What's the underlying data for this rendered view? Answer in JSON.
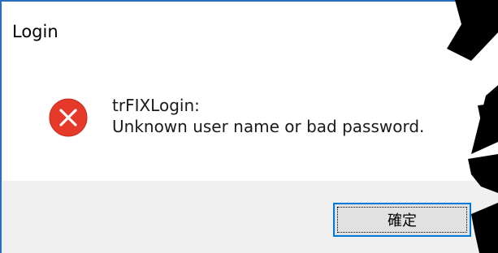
{
  "dialog": {
    "title": "Login",
    "message_source": "trFIXLogin:",
    "message_body": "Unknown user name or bad password.",
    "ok_label": "確定",
    "icon": "error-icon",
    "close_icon": "close-icon"
  },
  "colors": {
    "window_border": "#2b6fbe",
    "error_red": "#e81123",
    "button_focus": "#0078d7",
    "footer_bg": "#f0f0f0"
  }
}
